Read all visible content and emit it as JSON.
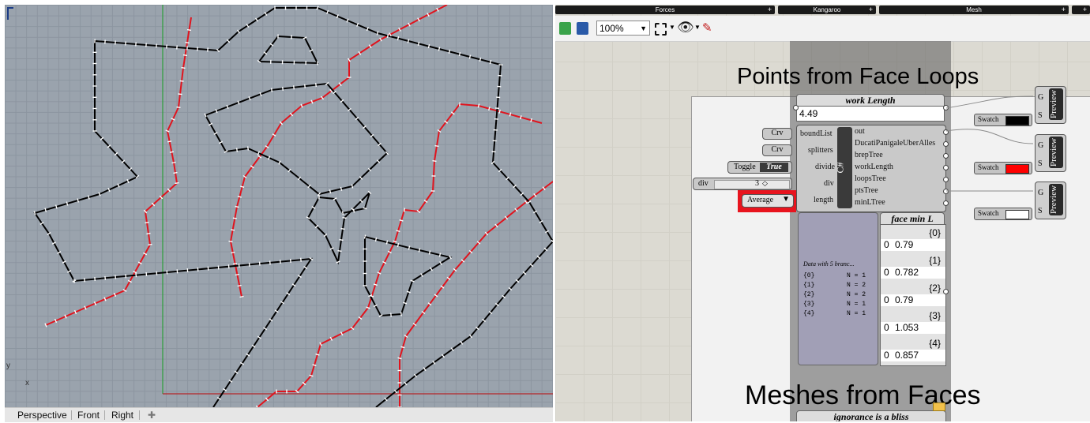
{
  "viewport": {
    "axis_y": "y",
    "axis_x": "x",
    "tabs": [
      "Perspective",
      "Front",
      "Right"
    ],
    "add_tab_icon": "plus-icon"
  },
  "ribbon": {
    "tabs": [
      "Forces",
      "Kangaroo",
      "Mesh"
    ]
  },
  "toolbar": {
    "zoom": "100%"
  },
  "canvas": {
    "heading_top": "Points from Face Loops",
    "heading_bottom": "Meshes from Faces",
    "work_length": {
      "title": "work Length",
      "value": "4.49"
    },
    "inputs": {
      "crv1": "Crv",
      "crv2": "Crv",
      "toggle_label": "Toggle",
      "toggle_value": "True",
      "div_label": "div",
      "div_value": "3",
      "average_label": "Average"
    },
    "csharp": {
      "label": "C#",
      "inputs": [
        "boundList",
        "splitters",
        "divide",
        "div",
        "length"
      ],
      "outputs": [
        "out",
        "DucatiPanigaleUberAlles",
        "brepTree",
        "workLength",
        "loopsTree",
        "ptsTree",
        "minLTree"
      ]
    },
    "data_panel": {
      "summary": "Data with 5 branc...",
      "rows": [
        {
          "branch": "{0}",
          "count": "N = 1"
        },
        {
          "branch": "{1}",
          "count": "N = 2"
        },
        {
          "branch": "{2}",
          "count": "N = 2"
        },
        {
          "branch": "{3}",
          "count": "N = 1"
        },
        {
          "branch": "{4}",
          "count": "N = 1"
        }
      ]
    },
    "face_min": {
      "title": "face min L",
      "branches": [
        {
          "path": "{0}",
          "index": "0",
          "value": "0.79"
        },
        {
          "path": "{1}",
          "index": "0",
          "value": "0.782"
        },
        {
          "path": "{2}",
          "index": "0",
          "value": "0.79"
        },
        {
          "path": "{3}",
          "index": "0",
          "value": "1.053"
        },
        {
          "path": "{4}",
          "index": "0",
          "value": "0.857"
        }
      ]
    },
    "previews": [
      {
        "label": "Preview",
        "g": "G",
        "s": "S",
        "swatch": "Swatch",
        "color": "#000000"
      },
      {
        "label": "Preview",
        "g": "G",
        "s": "S",
        "swatch": "Swatch",
        "color": "#ff0000"
      },
      {
        "label": "Preview",
        "g": "G",
        "s": "S",
        "swatch": "Swatch",
        "color": "#ffffff"
      }
    ],
    "bottom_panel_title": "ignorance is a bliss"
  },
  "colors": {
    "viewport_bg": "#9aa3ad",
    "curve_black": "#000000",
    "curve_red": "#e0141e",
    "axis_green": "#2e9e3c",
    "selection_red": "#e8141e",
    "canvas_bg": "#dcdad2"
  }
}
